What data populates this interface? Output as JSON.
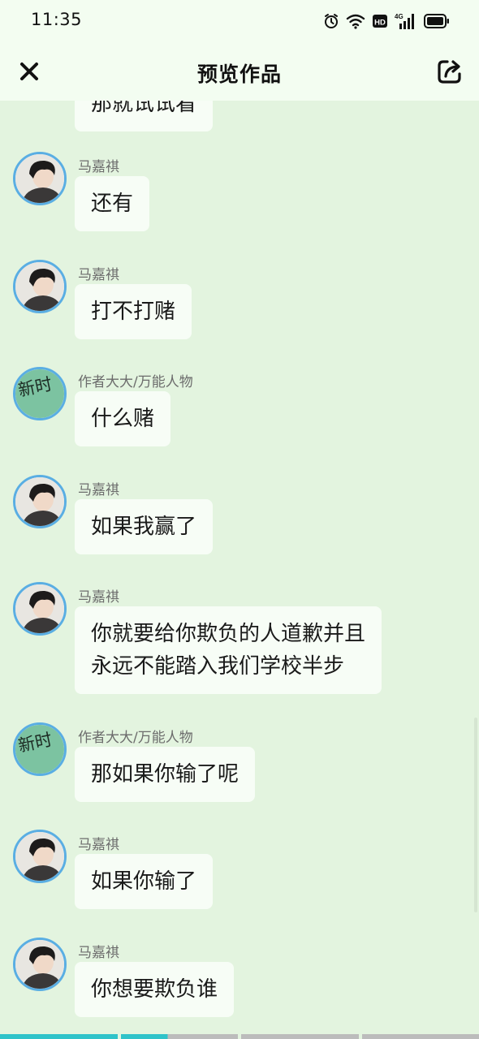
{
  "status_bar": {
    "time": "11:35",
    "icons": [
      "alarm-icon",
      "wifi-icon",
      "hd-icon",
      "signal-4g-icon",
      "battery-icon"
    ],
    "network_label": "4G",
    "hd_label": "HD"
  },
  "header": {
    "title": "预览作品",
    "close_icon": "close-icon",
    "share_icon": "share-icon"
  },
  "chat": {
    "partial_top_text": "那就试试看",
    "messages": [
      {
        "sender": "马嘉祺",
        "avatar": "portrait",
        "text": "还有"
      },
      {
        "sender": "马嘉祺",
        "avatar": "portrait",
        "text": "打不打赌"
      },
      {
        "sender": "作者大大/万能人物",
        "avatar": "author",
        "avatar_text": "新时",
        "text": "什么赌"
      },
      {
        "sender": "马嘉祺",
        "avatar": "portrait",
        "text": "如果我赢了"
      },
      {
        "sender": "马嘉祺",
        "avatar": "portrait",
        "text": "你就要给你欺负的人道歉并且\n永远不能踏入我们学校半步"
      },
      {
        "sender": "作者大大/万能人物",
        "avatar": "author",
        "avatar_text": "新时",
        "text": "那如果你输了呢"
      },
      {
        "sender": "马嘉祺",
        "avatar": "portrait",
        "text": "如果你输了"
      },
      {
        "sender": "马嘉祺",
        "avatar": "portrait",
        "text": "你想要欺负谁"
      }
    ]
  },
  "progress": {
    "segments": 4,
    "completed": 1.4
  },
  "colors": {
    "background": "#e3f4df",
    "header": "#f3fdf1",
    "bubble": "#f7fdf6",
    "avatar_border": "#5aaee3",
    "author_avatar_bg": "#7cc3a1",
    "progress_active": "#2fc3c9"
  }
}
